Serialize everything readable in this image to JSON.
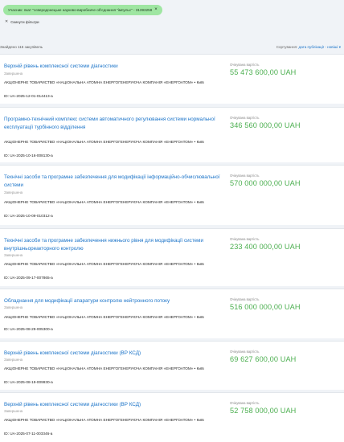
{
  "filters": {
    "chip_label": "Учасник: пкат \"сєверодонецьке науково-виробниче об'єднання \"імпульс\" - 31393258",
    "reset_label": "Скинути фільтри"
  },
  "results": {
    "count_label": "Знайдено 115 закупівель",
    "sort_prefix": "Сортування:",
    "sort_value": "дата публікації - новіші"
  },
  "tenders": [
    {
      "title": "Верхній рівень комплексної системи діагностики",
      "status": "Завершена",
      "organization": "АКЦІОНЕРНЕ ТОВАРИСТВО «НАЦІОНАЛЬНА АТОМНА ЕНЕРГОГЕНЕРУЮЧА КОМПАНІЯ «ЕНЕРГОАТОМ» • Київ",
      "id": "ID: UA-2025-12-01-014413-a",
      "value_label": "Очікувана вартість",
      "value": "55 473 600,00 UAH"
    },
    {
      "title": "Програмно-технічний комплекс системи автоматичного регулювання системи нормальної експлуатації турбінного відділення",
      "status": "Завершена",
      "organization": "АКЦІОНЕРНЕ ТОВАРИСТВО «НАЦІОНАЛЬНА АТОМНА ЕНЕРГОГЕНЕРУЮЧА КОМПАНІЯ «ЕНЕРГОАТОМ» • Київ",
      "id": "ID: UA-2025-10-16-008130-a",
      "value_label": "Очікувана вартість",
      "value": "346 560 000,00 UAH"
    },
    {
      "title": "Технічні засоби та програмне забезпечення для модифікації інформаційно-обчислювальної системи",
      "status": "Завершена",
      "organization": "АКЦІОНЕРНЕ ТОВАРИСТВО «НАЦІОНАЛЬНА АТОМНА ЕНЕРГОГЕНЕРУЮЧА КОМПАНІЯ «ЕНЕРГОАТОМ» • Київ",
      "id": "ID: UA-2025-10-09-010312-a",
      "value_label": "Очікувана вартість",
      "value": "570 000 000,00 UAH"
    },
    {
      "title": "Технічні засоби та програмне забезпечення нижнього рівня для модифікації системи внутрішньореакторного контролю",
      "status": "Завершена",
      "organization": "АКЦІОНЕРНЕ ТОВАРИСТВО «НАЦІОНАЛЬНА АТОМНА ЕНЕРГОГЕНЕРУЮЧА КОМПАНІЯ «ЕНЕРГОАТОМ» • Київ",
      "id": "ID: UA-2025-09-17-007865-a",
      "value_label": "Очікувана вартість",
      "value": "233 400 000,00 UAH"
    },
    {
      "title": "Обладнання для модифікації апаратури контролю нейтронного потоку",
      "status": "Завершена",
      "organization": "АКЦІОНЕРНЕ ТОВАРИСТВО «НАЦІОНАЛЬНА АТОМНА ЕНЕРГОГЕНЕРУЮЧА КОМПАНІЯ «ЕНЕРГОАТОМ» • Київ",
      "id": "ID: UA-2025-08-29-005300-a",
      "value_label": "Очікувана вартість",
      "value": "516 000 000,00 UAH"
    },
    {
      "title": "Верхній рівень комплексної системи діагностики (ВР КСД)",
      "status": "Завершена",
      "organization": "АКЦІОНЕРНЕ ТОВАРИСТВО «НАЦІОНАЛЬНА АТОМНА ЕНЕРГОГЕНЕРУЮЧА КОМПАНІЯ «ЕНЕРГОАТОМ» • Київ",
      "id": "ID: UA-2025-08-19-009930-a",
      "value_label": "Очікувана вартість",
      "value": "69 627 600,00 UAH"
    },
    {
      "title": "Верхній рівень комплексної системи діагностики (ВР КСД)",
      "status": "Завершена",
      "organization": "АКЦІОНЕРНЕ ТОВАРИСТВО «НАЦІОНАЛЬНА АТОМНА ЕНЕРГОГЕНЕРУЮЧА КОМПАНІЯ «ЕНЕРГОАТОМ» • Київ",
      "id": "ID: UA-2025-07-11-003346-a",
      "value_label": "Очікувана вартість",
      "value": "52 758 000,00 UAH"
    }
  ]
}
